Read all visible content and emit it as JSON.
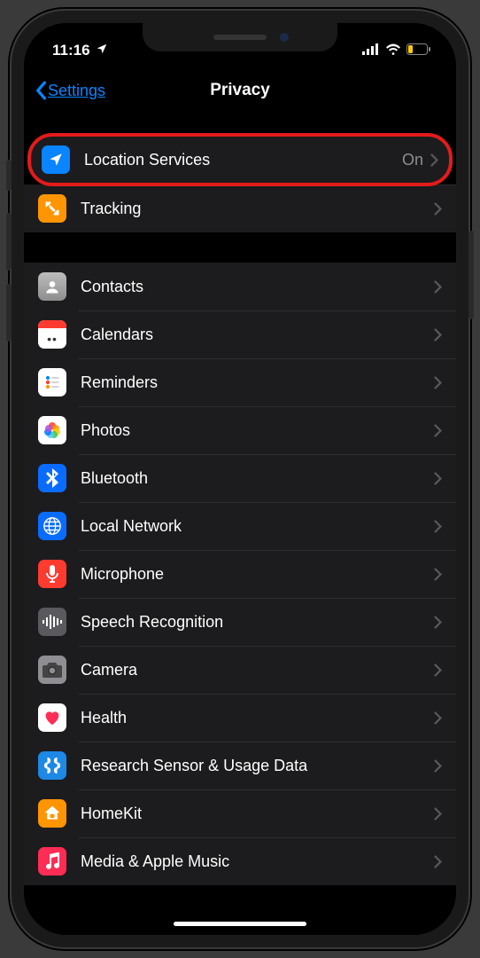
{
  "status": {
    "time": "11:16"
  },
  "nav": {
    "back": "Settings",
    "title": "Privacy"
  },
  "group1": [
    {
      "label": "Location Services",
      "value": "On",
      "icon": "location",
      "highlighted": true
    },
    {
      "label": "Tracking",
      "icon": "tracking"
    }
  ],
  "group2": [
    {
      "label": "Contacts",
      "icon": "contacts"
    },
    {
      "label": "Calendars",
      "icon": "calendars"
    },
    {
      "label": "Reminders",
      "icon": "reminders"
    },
    {
      "label": "Photos",
      "icon": "photos"
    },
    {
      "label": "Bluetooth",
      "icon": "bluetooth"
    },
    {
      "label": "Local Network",
      "icon": "localnet"
    },
    {
      "label": "Microphone",
      "icon": "mic"
    },
    {
      "label": "Speech Recognition",
      "icon": "speech"
    },
    {
      "label": "Camera",
      "icon": "camera"
    },
    {
      "label": "Health",
      "icon": "health"
    },
    {
      "label": "Research Sensor & Usage Data",
      "icon": "research"
    },
    {
      "label": "HomeKit",
      "icon": "homekit"
    },
    {
      "label": "Media & Apple Music",
      "icon": "media"
    }
  ]
}
